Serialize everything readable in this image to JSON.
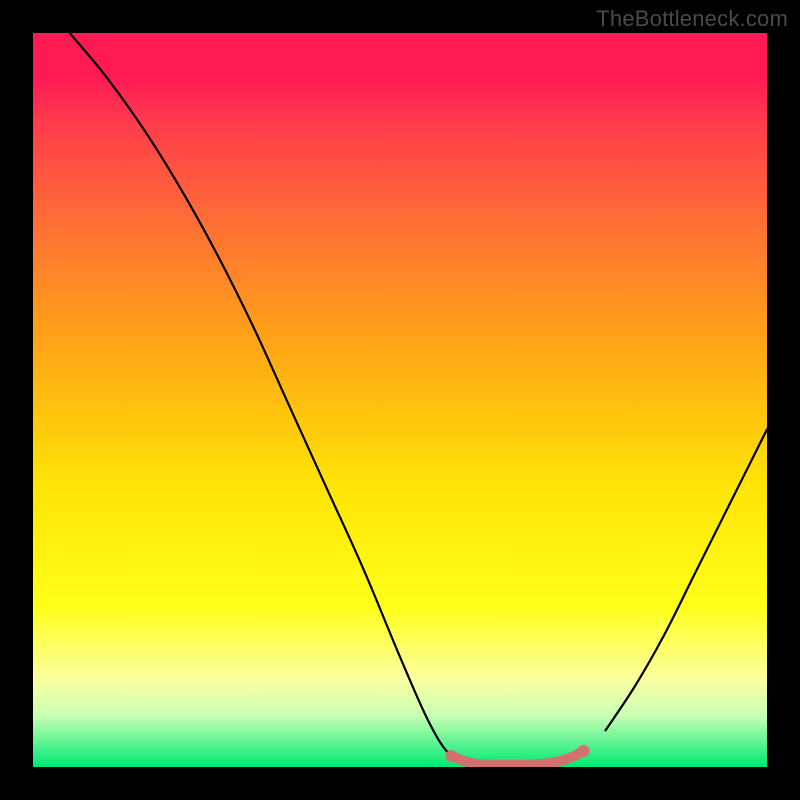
{
  "watermark": "TheBottleneck.com",
  "colors": {
    "frame": "#000000",
    "curve": "#000000",
    "highlight": "#d4716c",
    "gradient_top": "#ff1a54",
    "gradient_mid": "#ffe505",
    "gradient_bottom": "#00e874"
  },
  "chart_data": {
    "type": "line",
    "title": "",
    "xlabel": "",
    "ylabel": "",
    "xlim": [
      0,
      100
    ],
    "ylim": [
      0,
      100
    ],
    "grid": false,
    "series": [
      {
        "name": "left-branch",
        "x": [
          5,
          10,
          15,
          20,
          25,
          30,
          35,
          40,
          45,
          50,
          54,
          57,
          60
        ],
        "y": [
          100,
          94,
          87,
          79,
          70,
          60,
          49,
          38,
          27,
          15,
          6,
          1.5,
          0.5
        ]
      },
      {
        "name": "valley-highlight",
        "x": [
          57,
          60,
          65,
          70,
          73,
          75
        ],
        "y": [
          1.5,
          0.5,
          0.3,
          0.5,
          1.2,
          2.2
        ],
        "highlighted": true
      },
      {
        "name": "right-branch",
        "x": [
          75,
          78,
          82,
          86,
          90,
          94,
          98,
          100
        ],
        "y": [
          2.2,
          5,
          11,
          18,
          26,
          34,
          42,
          46
        ]
      }
    ]
  }
}
